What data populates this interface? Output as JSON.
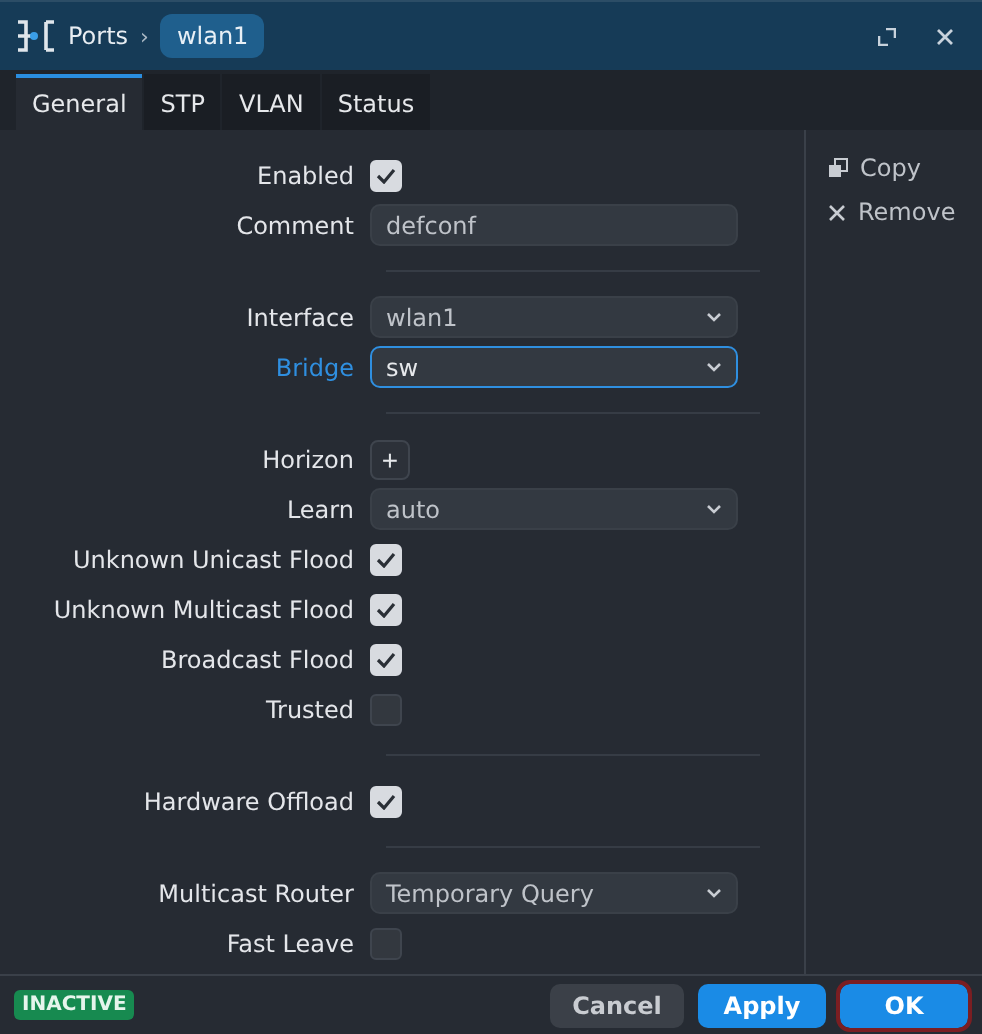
{
  "title_bar": {
    "section": "Ports",
    "separator": "›",
    "item": "wlan1"
  },
  "tabs": [
    {
      "label": "General",
      "selected": true
    },
    {
      "label": "STP",
      "selected": false
    },
    {
      "label": "VLAN",
      "selected": false
    },
    {
      "label": "Status",
      "selected": false
    }
  ],
  "fields": [
    {
      "kind": "checkbox",
      "label": "Enabled",
      "checked": true
    },
    {
      "kind": "text",
      "label": "Comment",
      "value": "defconf"
    },
    {
      "kind": "separator"
    },
    {
      "kind": "select",
      "label": "Interface",
      "value": "wlan1",
      "focused": false
    },
    {
      "kind": "select",
      "label": "Bridge",
      "value": "sw",
      "focused": true
    },
    {
      "kind": "separator"
    },
    {
      "kind": "add",
      "label": "Horizon",
      "symbol": "+"
    },
    {
      "kind": "select",
      "label": "Learn",
      "value": "auto",
      "focused": false
    },
    {
      "kind": "checkbox",
      "label": "Unknown Unicast Flood",
      "checked": true
    },
    {
      "kind": "checkbox",
      "label": "Unknown Multicast Flood",
      "checked": true
    },
    {
      "kind": "checkbox",
      "label": "Broadcast Flood",
      "checked": true
    },
    {
      "kind": "checkbox",
      "label": "Trusted",
      "checked": false
    },
    {
      "kind": "separator"
    },
    {
      "kind": "checkbox",
      "label": "Hardware Offload",
      "checked": true
    },
    {
      "kind": "separator"
    },
    {
      "kind": "select",
      "label": "Multicast Router",
      "value": "Temporary Query",
      "focused": false
    },
    {
      "kind": "checkbox",
      "label": "Fast Leave",
      "checked": false
    }
  ],
  "actions": [
    {
      "kind": "copy",
      "label": "Copy"
    },
    {
      "kind": "remove",
      "label": "Remove"
    }
  ],
  "status_badge": "INACTIVE",
  "buttons": [
    {
      "label": "Cancel",
      "kind": "secondary",
      "focused": false
    },
    {
      "label": "Apply",
      "kind": "primary",
      "focused": false
    },
    {
      "label": "OK",
      "kind": "primary",
      "focused": true
    }
  ]
}
